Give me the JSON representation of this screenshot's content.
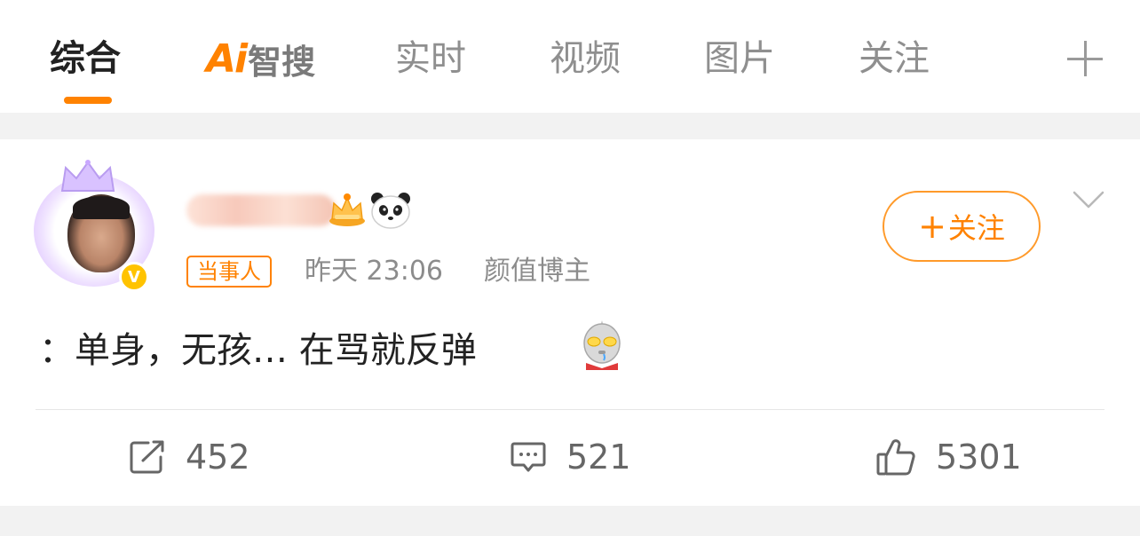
{
  "tabs": [
    {
      "label": "综合",
      "active": true
    },
    {
      "label": "实时",
      "active": false
    },
    {
      "label": "视频",
      "active": false
    },
    {
      "label": "图片",
      "active": false
    },
    {
      "label": "关注",
      "active": false
    }
  ],
  "ai_tab": {
    "mark": "Ai",
    "label": "智搜"
  },
  "colors": {
    "accent": "#ff8200",
    "badge": "#ffc300",
    "tab_inactive": "#8f8f8f"
  },
  "icons": {
    "add_tab": "plus-icon",
    "more": "chevron-down-icon",
    "repost": "repost-icon",
    "comment": "comment-icon",
    "like": "thumbs-up-icon",
    "verified": "verified-badge-icon",
    "name_emoji_1": "crown-icon",
    "name_emoji_2": "panda-icon",
    "text_emoji": "ultraman-emoji-icon"
  },
  "post": {
    "role_tag": "当事人",
    "time": "昨天 23:06",
    "source": "颜值博主",
    "verified_mark": "V",
    "follow_plus": "+",
    "follow_label": "关注",
    "text": "：单身，无孩… 在骂就反弹",
    "stats": {
      "reposts": "452",
      "comments": "521",
      "likes": "5301"
    }
  }
}
